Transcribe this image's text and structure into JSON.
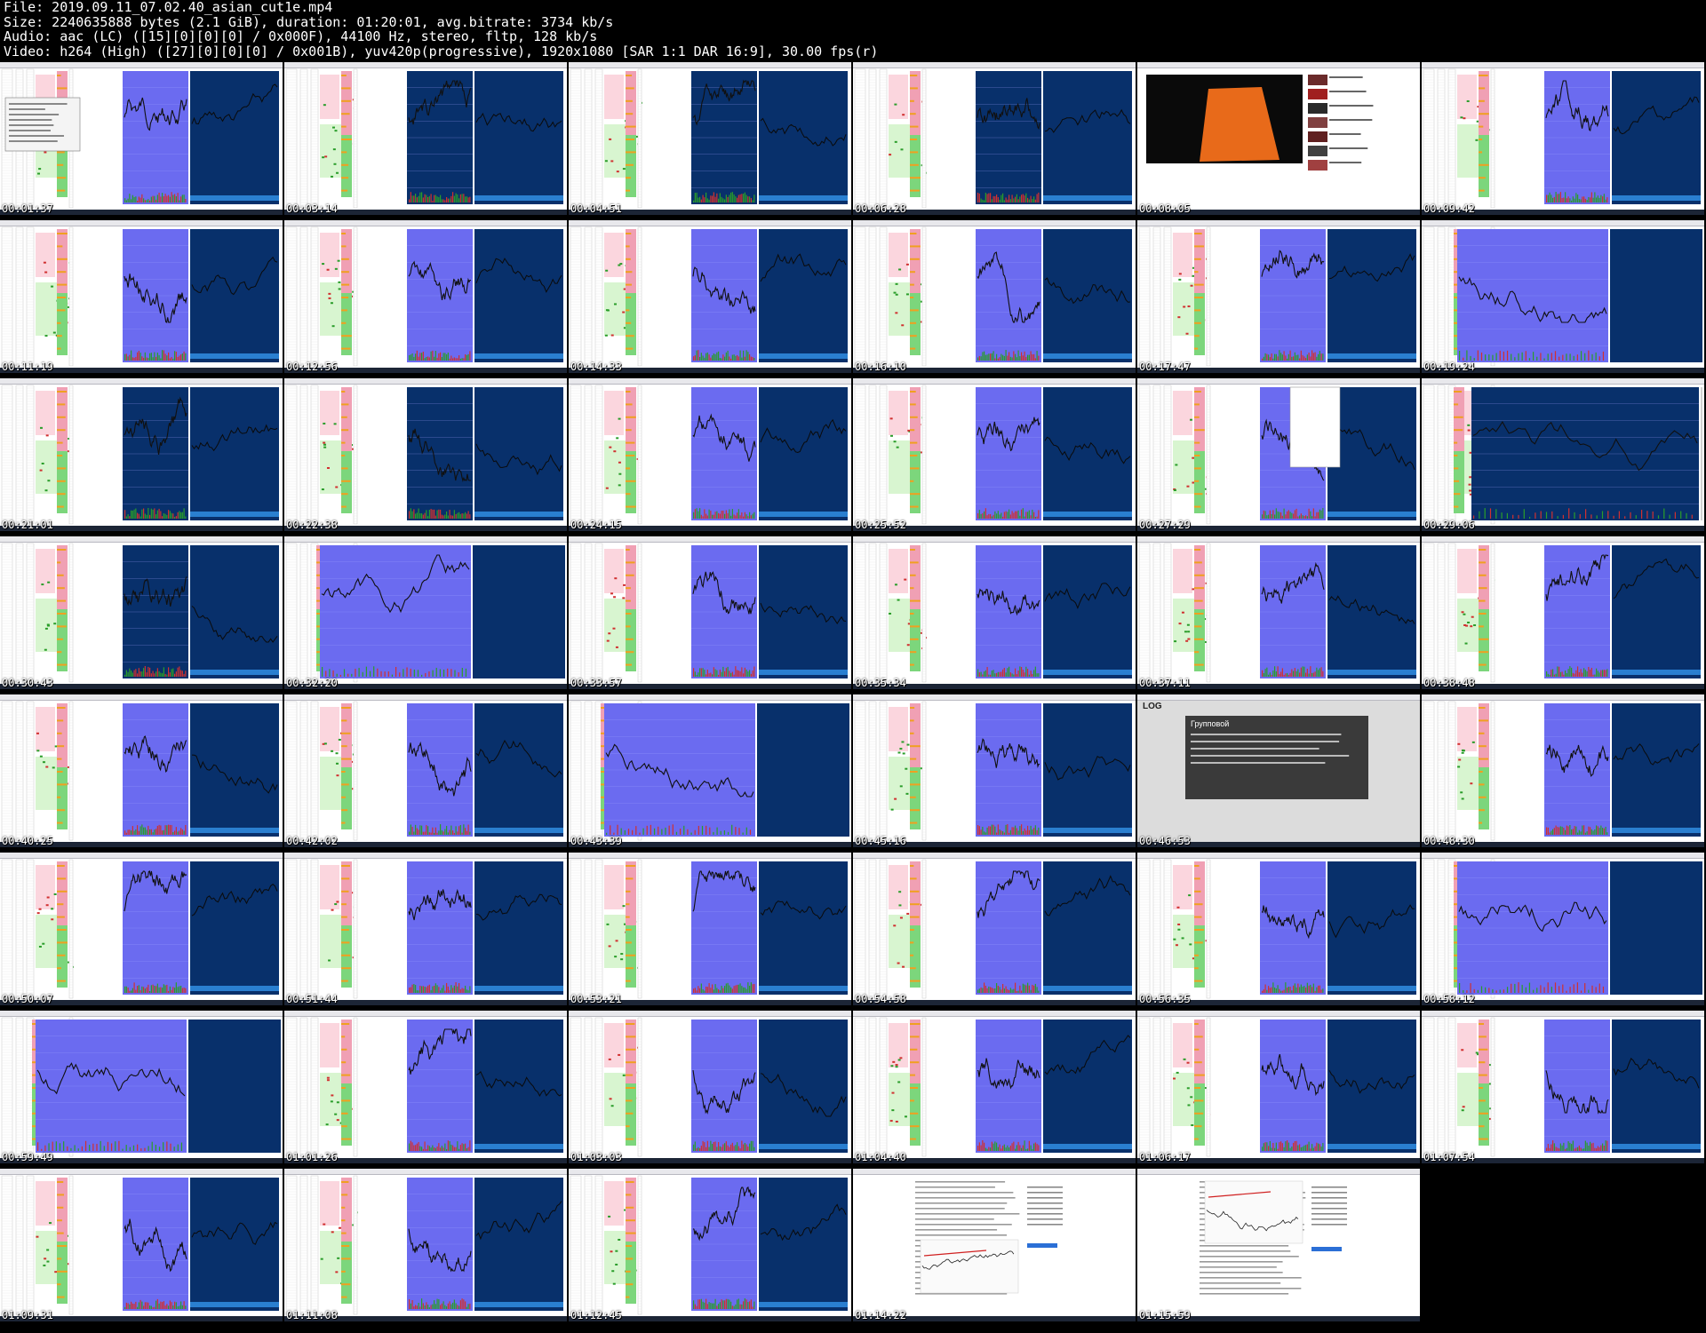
{
  "file_info": {
    "file": "File: 2019.09.11_07.02.40_asian_cut1e.mp4",
    "size": "Size: 2240635888 bytes (2.1 GiB), duration: 01:20:01, avg.bitrate: 3734 kb/s",
    "audio": "Audio: aac (LC) ([15][0][0][0] / 0x000F), 44100 Hz, stereo, fltp, 128 kb/s",
    "video": "Video: h264 (High) ([27][0][0][0] / 0x001B), yuv420p(progressive), 1920x1080 [SAR 1:1 DAR 16:9], 30.00 fps(r)"
  },
  "thumbnails": [
    {
      "time": "00:01:37",
      "type": "dialog"
    },
    {
      "time": "00:03:14",
      "type": "dark"
    },
    {
      "time": "00:04:51",
      "type": "dark"
    },
    {
      "time": "00:06:28",
      "type": "dark"
    },
    {
      "time": "00:08:05",
      "type": "youtube"
    },
    {
      "time": "00:09:42",
      "type": "blue"
    },
    {
      "time": "00:11:19",
      "type": "blue"
    },
    {
      "time": "00:12:56",
      "type": "blue"
    },
    {
      "time": "00:14:33",
      "type": "blue"
    },
    {
      "time": "00:16:10",
      "type": "blue"
    },
    {
      "time": "00:17:47",
      "type": "blue"
    },
    {
      "time": "00:19:24",
      "type": "wide"
    },
    {
      "time": "00:21:01",
      "type": "dark"
    },
    {
      "time": "00:22:38",
      "type": "dark"
    },
    {
      "time": "00:24:15",
      "type": "blue"
    },
    {
      "time": "00:25:52",
      "type": "blue"
    },
    {
      "time": "00:27:29",
      "type": "popup"
    },
    {
      "time": "00:29:06",
      "type": "darkwide"
    },
    {
      "time": "00:30:43",
      "type": "dark"
    },
    {
      "time": "00:32:20",
      "type": "wide"
    },
    {
      "time": "00:33:57",
      "type": "blue"
    },
    {
      "time": "00:35:34",
      "type": "blue"
    },
    {
      "time": "00:37:11",
      "type": "blue"
    },
    {
      "time": "00:38:48",
      "type": "blue"
    },
    {
      "time": "00:40:25",
      "type": "blue"
    },
    {
      "time": "00:42:02",
      "type": "blue"
    },
    {
      "time": "00:43:39",
      "type": "wide"
    },
    {
      "time": "00:45:16",
      "type": "blue"
    },
    {
      "time": "00:46:53",
      "type": "web"
    },
    {
      "time": "00:48:30",
      "type": "blue"
    },
    {
      "time": "00:50:07",
      "type": "blue"
    },
    {
      "time": "00:51:44",
      "type": "blue"
    },
    {
      "time": "00:53:21",
      "type": "blue"
    },
    {
      "time": "00:54:58",
      "type": "blue"
    },
    {
      "time": "00:56:35",
      "type": "blue"
    },
    {
      "time": "00:58:12",
      "type": "wide"
    },
    {
      "time": "00:59:49",
      "type": "wide"
    },
    {
      "time": "01:01:26",
      "type": "blue"
    },
    {
      "time": "01:03:03",
      "type": "blue"
    },
    {
      "time": "01:04:40",
      "type": "blue"
    },
    {
      "time": "01:06:17",
      "type": "blue"
    },
    {
      "time": "01:07:54",
      "type": "blue"
    },
    {
      "time": "01:09:31",
      "type": "blue"
    },
    {
      "time": "01:11:08",
      "type": "blue"
    },
    {
      "time": "01:12:45",
      "type": "blue"
    },
    {
      "time": "01:14:22",
      "type": "article"
    },
    {
      "time": "01:15:59",
      "type": "article2"
    }
  ],
  "web_page": {
    "logo": "LOG",
    "heading": "Групповой"
  },
  "colors": {
    "chart_blue": "#6b6bf0",
    "chart_dark": "#08306b",
    "ladder_red": "#f0a0b4",
    "ladder_green": "#7cd67c",
    "ladder_orange": "#f0a020",
    "pink_zone": "#fbd6de",
    "green_zone": "#d8f5d0",
    "price_line": "#101010"
  }
}
